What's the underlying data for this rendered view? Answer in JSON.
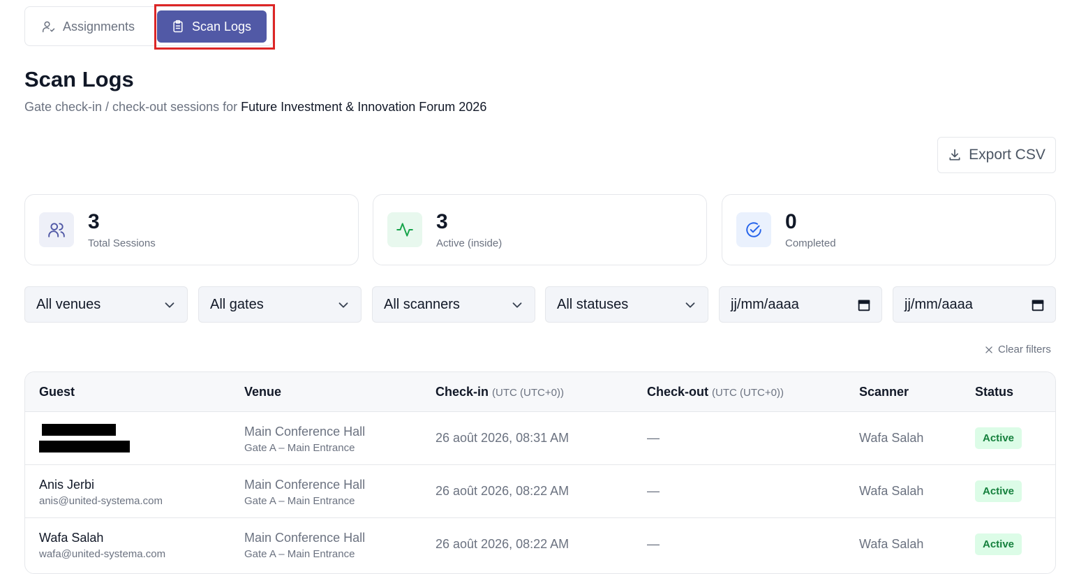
{
  "tabs": [
    {
      "label": "Assignments",
      "icon": "user-check-icon",
      "active": false
    },
    {
      "label": "Scan Logs",
      "icon": "clipboard-list-icon",
      "active": true
    }
  ],
  "header": {
    "title": "Scan Logs",
    "subtitle_prefix": "Gate check-in / check-out sessions for ",
    "event_name": "Future Investment & Innovation Forum 2026"
  },
  "export_label": "Export CSV",
  "stats": [
    {
      "value": "3",
      "label": "Total Sessions",
      "icon": "users-icon",
      "color": "#5159a6",
      "bg": "#eef0f8"
    },
    {
      "value": "3",
      "label": "Active (inside)",
      "icon": "activity-icon",
      "color": "#16a34a",
      "bg": "#e8f8ee"
    },
    {
      "value": "0",
      "label": "Completed",
      "icon": "check-circle-icon",
      "color": "#2563eb",
      "bg": "#eaf1fd"
    }
  ],
  "filters": {
    "venue": "All venues",
    "gate": "All gates",
    "scanner": "All scanners",
    "status": "All statuses",
    "date_from_placeholder": "jj/mm/aaaa",
    "date_to_placeholder": "jj/mm/aaaa"
  },
  "clear_filters": "Clear filters",
  "table": {
    "columns": {
      "guest": "Guest",
      "venue": "Venue",
      "checkin": "Check-in",
      "checkin_tz": "(UTC (UTC+0))",
      "checkout": "Check-out",
      "checkout_tz": "(UTC (UTC+0))",
      "scanner": "Scanner",
      "status": "Status"
    },
    "rows": [
      {
        "name": "",
        "email": "",
        "venue": "Main Conference Hall",
        "gate": "Gate A – Main Entrance",
        "checkin": "26 août 2026, 08:31 AM",
        "checkout": "—",
        "scanner": "Wafa Salah",
        "status": "Active"
      },
      {
        "name": "Anis Jerbi",
        "email": "anis@united-systema.com",
        "venue": "Main Conference Hall",
        "gate": "Gate A – Main Entrance",
        "checkin": "26 août 2026, 08:22 AM",
        "checkout": "—",
        "scanner": "Wafa Salah",
        "status": "Active"
      },
      {
        "name": "Wafa Salah",
        "email": "wafa@united-systema.com",
        "venue": "Main Conference Hall",
        "gate": "Gate A – Main Entrance",
        "checkin": "26 août 2026, 08:22 AM",
        "checkout": "—",
        "scanner": "Wafa Salah",
        "status": "Active"
      }
    ]
  }
}
